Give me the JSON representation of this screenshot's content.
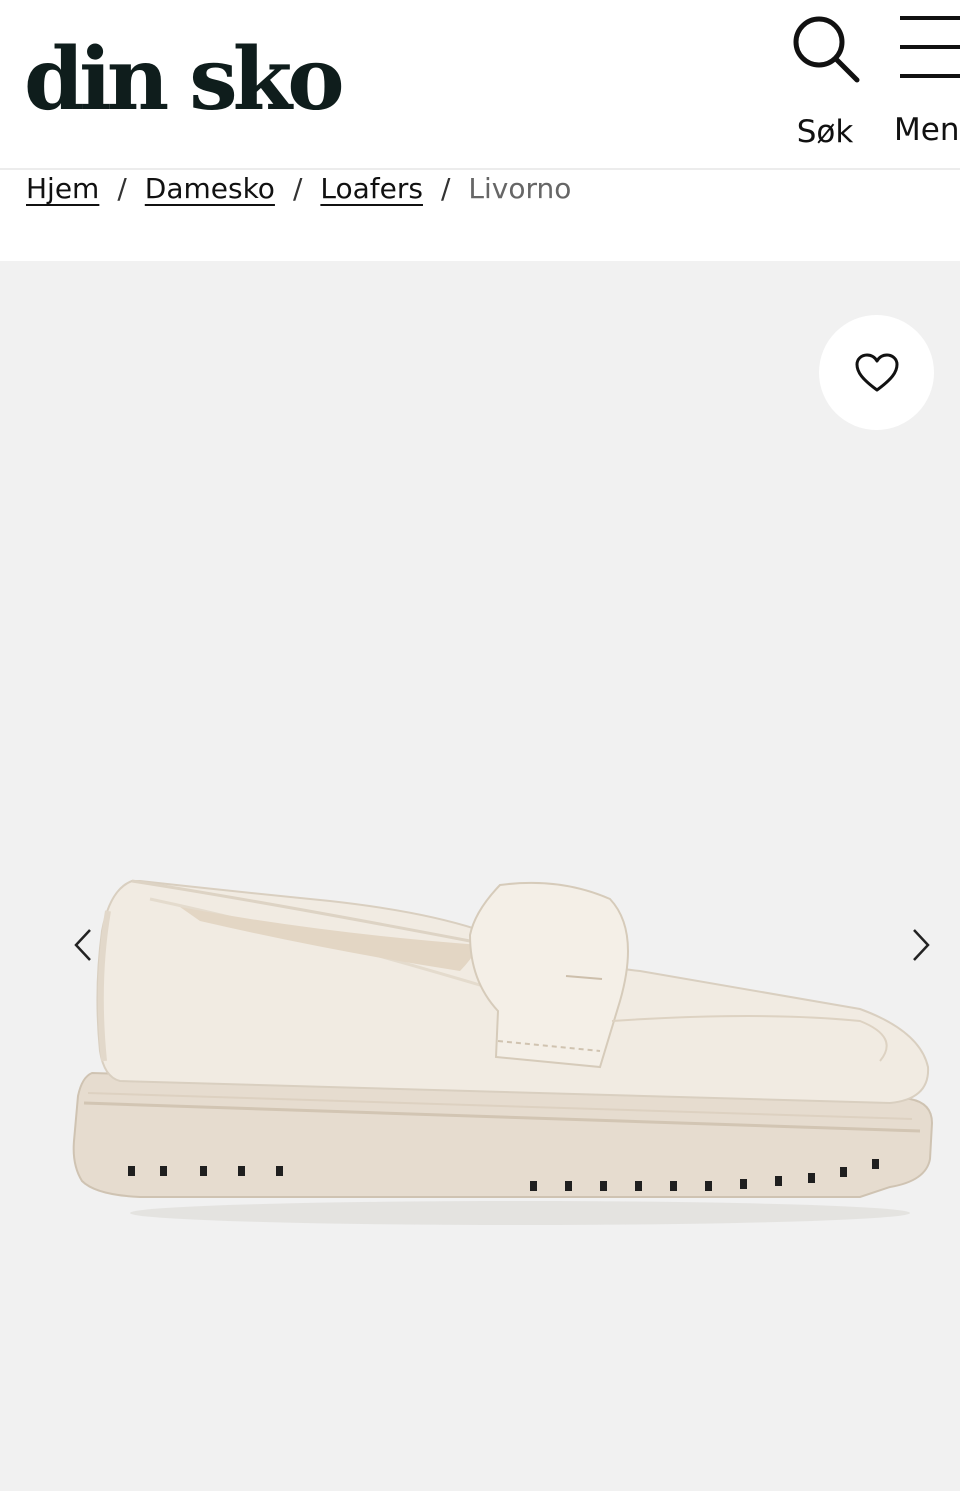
{
  "header": {
    "logo_text": "din sko",
    "search_label": "Søk",
    "menu_label": "Meny"
  },
  "breadcrumb": {
    "items": [
      "Hjem",
      "Damesko",
      "Loafers"
    ],
    "current": "Livorno",
    "separator": "/"
  },
  "gallery": {
    "product_image": "cream chunky loafer shoe",
    "favorite_icon": "heart-icon",
    "prev_icon": "chevron-left-icon",
    "next_icon": "chevron-right-icon"
  },
  "colors": {
    "logo": "#0f1d1c",
    "gallery_bg": "#f1f1f1",
    "shoe": "#efe9df"
  }
}
